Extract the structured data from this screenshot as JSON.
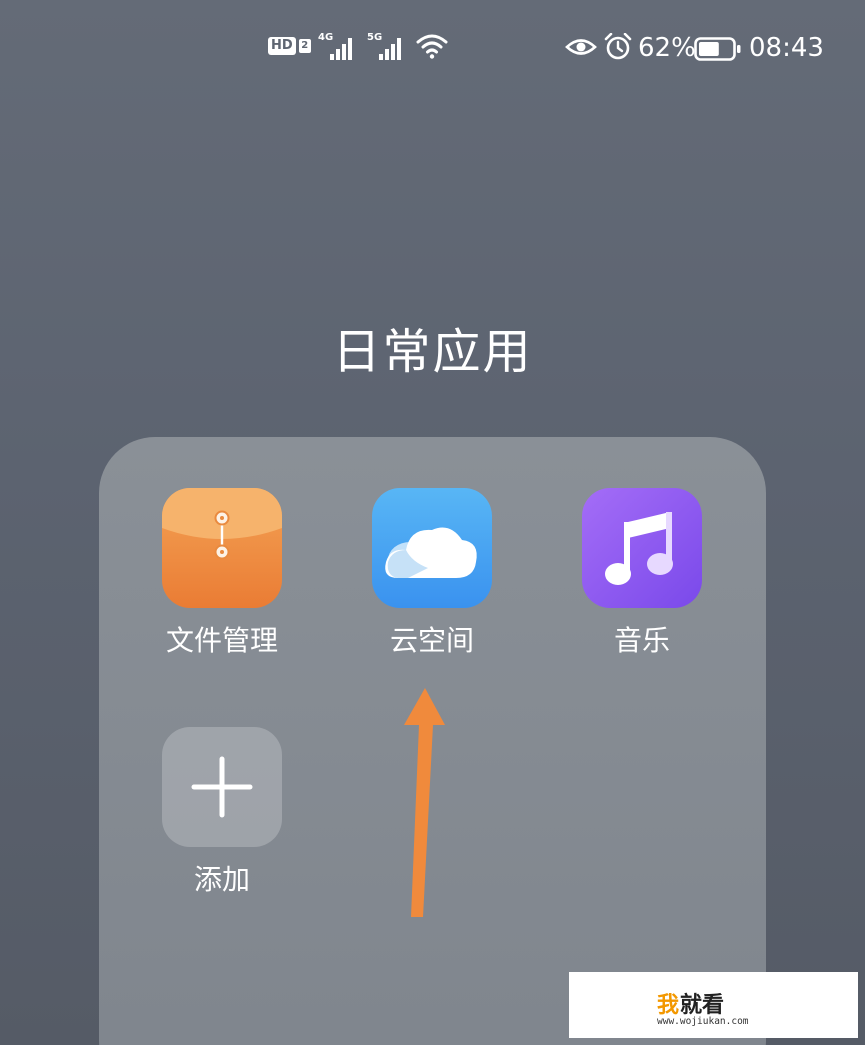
{
  "status_bar": {
    "hd_label": "HD",
    "hd_sim": "2",
    "signal_1_gen": "4G",
    "signal_2_gen": "5G",
    "battery_percent": "62%",
    "battery_level": 0.62,
    "time": "08:43",
    "icons": [
      "hd-icon",
      "signal-icon",
      "signal-icon",
      "wifi-icon",
      "eye-icon",
      "alarm-icon",
      "battery-icon"
    ]
  },
  "folder": {
    "title": "日常应用",
    "apps": [
      {
        "label": "文件管理",
        "icon": "file-manager-icon"
      },
      {
        "label": "云空间",
        "icon": "cloud-icon"
      },
      {
        "label": "音乐",
        "icon": "music-icon"
      },
      {
        "label": "添加",
        "icon": "plus-icon"
      }
    ]
  },
  "colors": {
    "files_icon": "#ee8a3f",
    "cloud_icon": "#4aa6f2",
    "music_icon": "#8e5bf1",
    "arrow": "#f08a3c",
    "background": "#5c6370"
  },
  "watermark": {
    "logo_text": "我就看",
    "url": "www.wojiukan.com",
    "accent": "#f39800"
  }
}
